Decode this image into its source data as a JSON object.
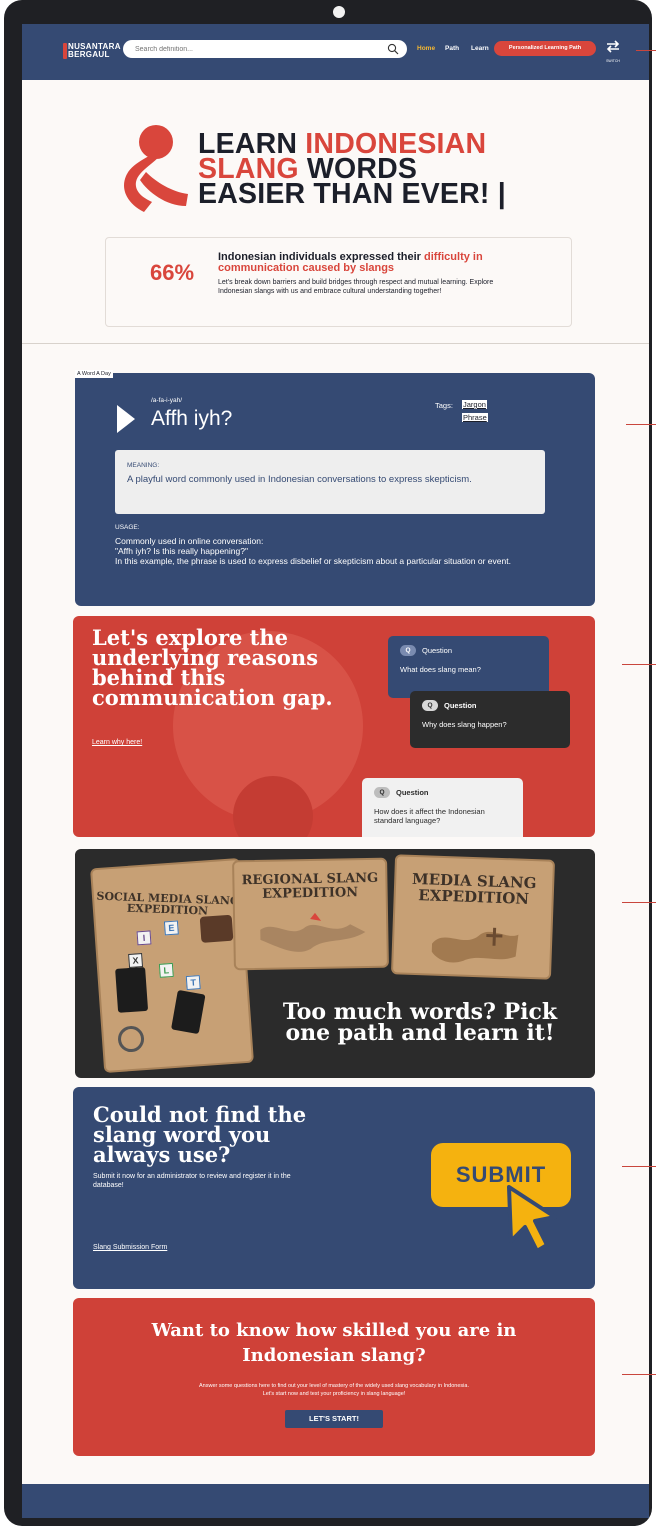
{
  "nav": {
    "logo_line1": "NUSANTARA",
    "logo_line2": "BERGAUL",
    "search_placeholder": "Search definition...",
    "links": {
      "home": "Home",
      "path": "Path",
      "learn": "Learn"
    },
    "personalized_button": "Personalized Learning Path",
    "switch_label": "SWITCH",
    "accent": "#f5b731"
  },
  "hero": {
    "title_learn": "LEARN ",
    "title_indonesian": "INDONESIAN",
    "title_slang": "SLANG",
    "title_words": " WORDS",
    "title_line3": "EASIER THAN EVER! |",
    "stat_percent": "66%",
    "stat_head_plain": "Indonesian individuals expressed their ",
    "stat_head_red": "difficulty in communication caused by slangs",
    "stat_body": "Let's break down barriers and build bridges through respect and mutual learning. Explore Indonesian slangs with us and embrace cultural understanding together!"
  },
  "word_of_day": {
    "section_tag": "A Word A Day",
    "pronunciation": "/a-fa-i-yah/",
    "word": "Affh iyh?",
    "tags_label": "Tags:",
    "tags": [
      "Jargon",
      "Phrase"
    ],
    "meaning_label": "MEANING:",
    "meaning_text": "A playful word commonly used in Indonesian conversations to express skepticism.",
    "usage_label": "USAGE:",
    "usage_line1": "Commonly used in online conversation:",
    "usage_line2": "\"Affh iyh? Is this really happening?\"",
    "usage_line3": "In this example, the phrase is used to express disbelief or skepticism about a particular situation or event."
  },
  "reasons": {
    "title": "Let's explore the underlying reasons behind this communication gap.",
    "link": "Learn why here!",
    "badge": "Q",
    "questions": [
      {
        "title": "Question",
        "text": "What does slang mean?"
      },
      {
        "title": "Question",
        "text": "Why does slang happen?"
      },
      {
        "title": "Question",
        "text": "How does it affect the Indonesian standard language?"
      }
    ]
  },
  "paths": {
    "cards": [
      "SOCIAL MEDIA SLANG EXPEDITION",
      "REGIONAL SLANG EXPEDITION",
      "MEDIA SLANG EXPEDITION"
    ],
    "tiles": [
      "I",
      "E",
      "X",
      "L",
      "T"
    ],
    "title": "Too much words? Pick one path and learn it!"
  },
  "submit": {
    "title": "Could not find the slang word you always use?",
    "body": "Submit it now for an administrator to review and register it in the database!",
    "link": "Slang Submission Form",
    "button": "SUBMIT",
    "button_color": "#f5b20f"
  },
  "quiz": {
    "title": "Want to know how skilled you are in Indonesian slang?",
    "body_line1": "Answer some questions here to find out your level of mastery of the widely used slang vocabulary in Indonesia.",
    "body_line2": "Let's start now and test your proficiency in slang language!",
    "button": "LET'S START!"
  },
  "colors": {
    "navy": "#354a73",
    "red": "#d9463c",
    "dark": "#2b2b2b"
  }
}
